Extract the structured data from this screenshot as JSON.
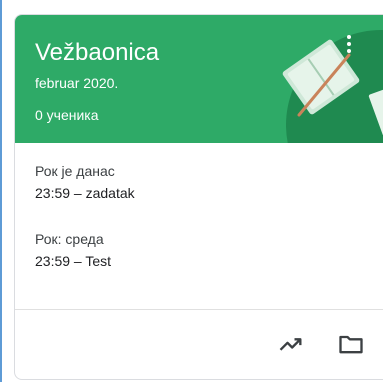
{
  "card": {
    "title": "Vežbaonica",
    "subtitle": "februar 2020.",
    "students": "0 ученика"
  },
  "due": [
    {
      "label": "Рок је данас",
      "item": "23:59 – zadatak"
    },
    {
      "label": "Рок: среда",
      "item": "23:59 – Test"
    }
  ],
  "footer": {
    "icons": [
      "trending-up-icon",
      "folder-icon"
    ]
  },
  "colors": {
    "header": "#2eaa67",
    "header_dark": "#1f8a50",
    "text": "#202124"
  }
}
